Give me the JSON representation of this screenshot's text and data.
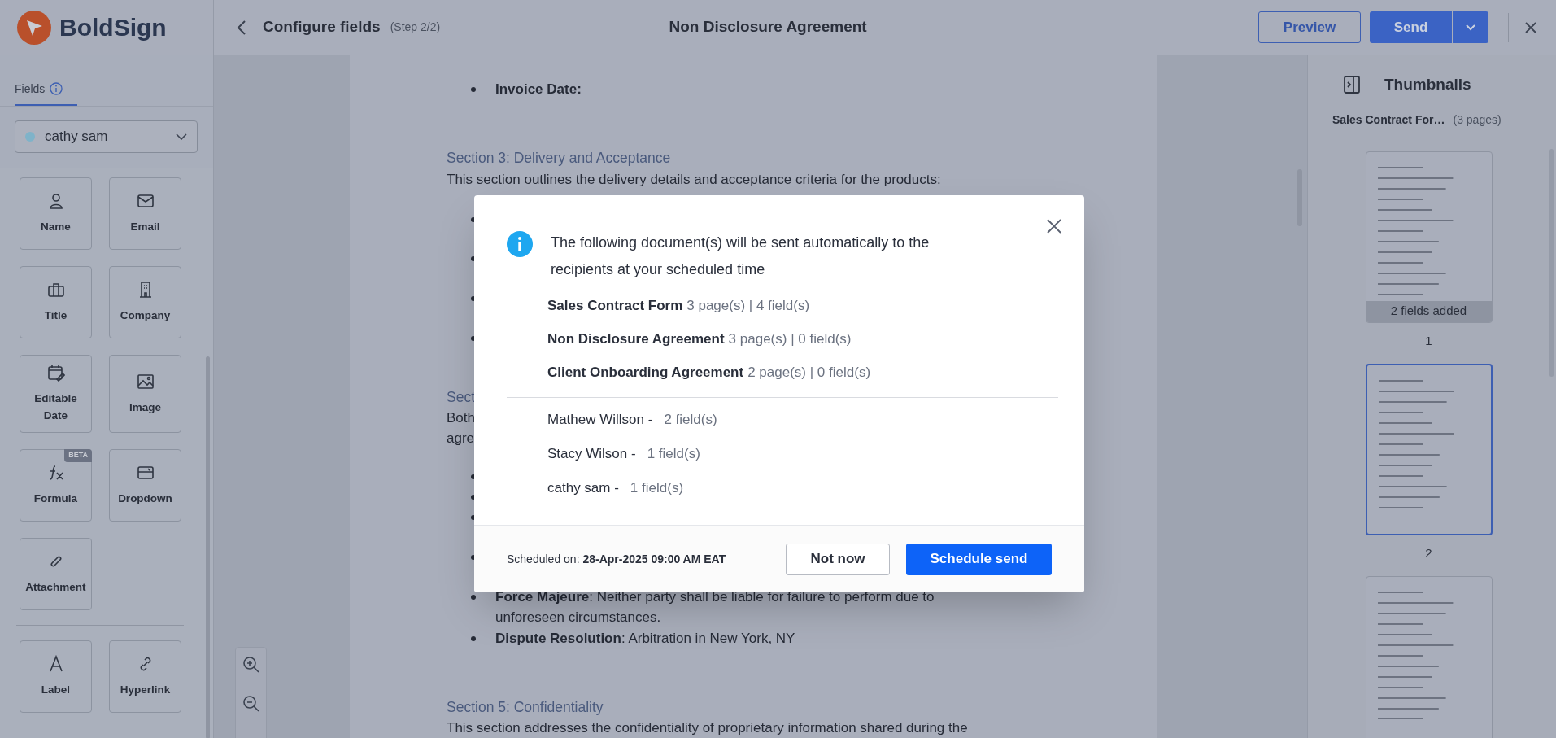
{
  "header": {
    "logo_text": "BoldSign",
    "title": "Configure fields",
    "step": "(Step 2/2)",
    "document_title": "Non Disclosure Agreement",
    "preview_button": "Preview",
    "send_button": "Send"
  },
  "sidebar": {
    "tabs": [
      {
        "label": "Fields",
        "selected": true
      }
    ],
    "recipient": {
      "name": "cathy sam",
      "color": "#7fb3c9"
    },
    "field_groups": [
      [
        {
          "label": "Name"
        },
        {
          "label": "Email"
        },
        {
          "label": "Title"
        },
        {
          "label": "Company"
        },
        {
          "label": "Editable Date"
        },
        {
          "label": "Image"
        },
        {
          "label": "Formula",
          "badge": "BETA"
        },
        {
          "label": "Dropdown"
        },
        {
          "label": "Attachment"
        }
      ],
      [
        {
          "label": "Label"
        },
        {
          "label": "Hyperlink"
        }
      ]
    ]
  },
  "document": {
    "lines": [
      {
        "kind": "bullet",
        "text": "**Invoice Date:**"
      },
      {
        "kind": "heading",
        "text": "Section 3: Delivery and Acceptance"
      },
      {
        "kind": "text",
        "text": "This section outlines the delivery details and acceptance criteria for the products:"
      },
      {
        "kind": "dot"
      },
      {
        "kind": "dot"
      },
      {
        "kind": "dot"
      },
      {
        "kind": "dot"
      },
      {
        "kind": "heading",
        "text": "Sect"
      },
      {
        "kind": "text",
        "text": "Both"
      },
      {
        "kind": "text",
        "text": "agre"
      },
      {
        "kind": "dot"
      },
      {
        "kind": "dot"
      },
      {
        "kind": "dot"
      },
      {
        "kind": "dot"
      },
      {
        "kind": "bullet",
        "text": "**Force Majeure**: Neither party shall be liable for failure to perform due to unforeseen circumstances."
      },
      {
        "kind": "bullet",
        "text": "**Dispute Resolution**: Arbitration in New York, NY"
      },
      {
        "kind": "heading",
        "text": "Section 5: Confidentiality"
      },
      {
        "kind": "text",
        "text": "This section addresses the confidentiality of proprietary information shared during the"
      }
    ]
  },
  "thumbnails": {
    "title": "Thumbnails",
    "document_name": "Sales Contract For…",
    "page_count": "(3 pages)",
    "pages": [
      {
        "number": "1",
        "badge": "2 fields added",
        "selected": false
      },
      {
        "number": "2",
        "selected": true
      },
      {
        "selected": false
      }
    ]
  },
  "dialog": {
    "message": "The following document(s) will be sent automatically to the recipients at your scheduled time",
    "documents": [
      {
        "name": "Sales Contract Form",
        "details": "3 page(s) | 4 field(s)"
      },
      {
        "name": "Non Disclosure Agreement",
        "details": "3 page(s) | 0 field(s)"
      },
      {
        "name": "Client Onboarding Agreement",
        "details": "2 page(s) | 0 field(s)"
      }
    ],
    "recipients": [
      {
        "name": "Mathew Willson -",
        "fields": "2 field(s)"
      },
      {
        "name": "Stacy Wilson -",
        "fields": "1 field(s)"
      },
      {
        "name": "cathy sam -",
        "fields": "1 field(s)"
      }
    ],
    "schedule_label": "Scheduled on:",
    "schedule_value": "28-Apr-2025 09:00 AM EAT",
    "cancel_button": "Not now",
    "confirm_button": "Schedule send"
  }
}
